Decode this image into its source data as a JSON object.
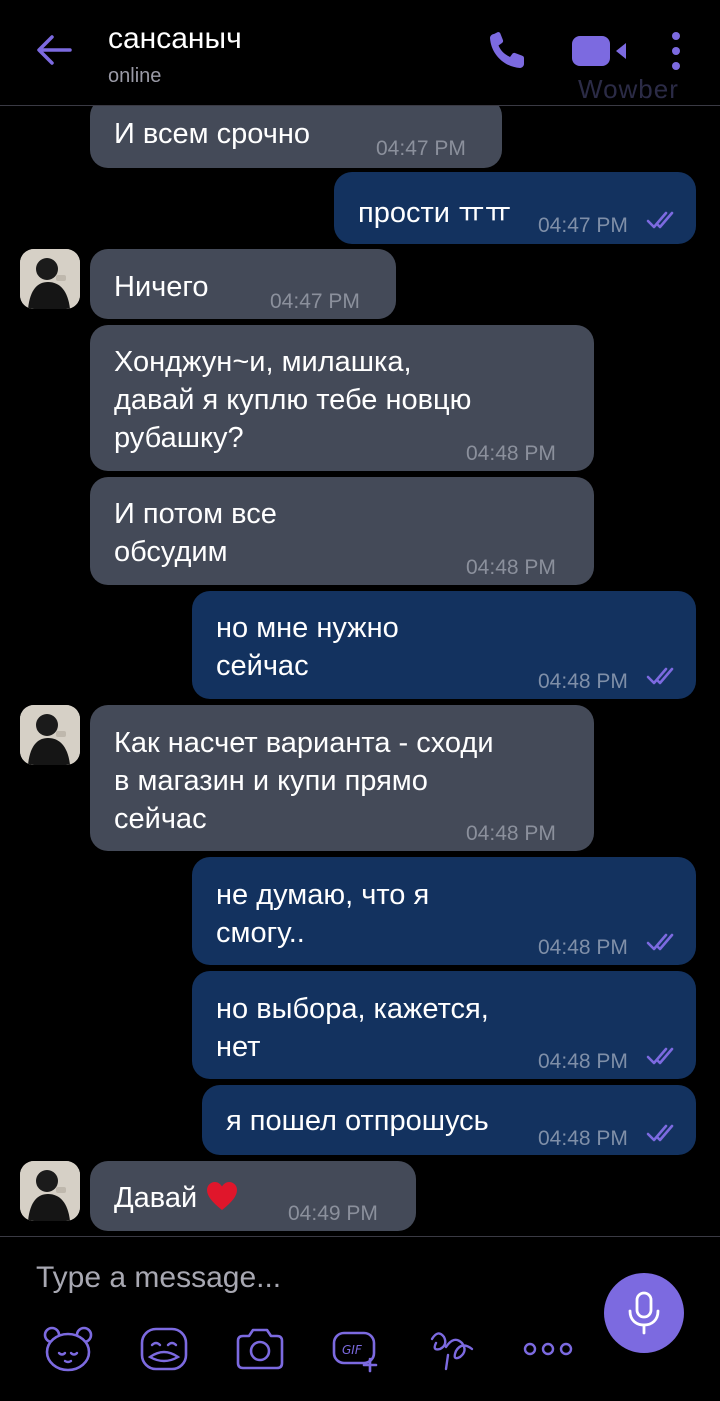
{
  "header": {
    "contact_name": "сансаныч",
    "status": "online",
    "brand_watermark": "Wowber",
    "back_icon": "arrow-left-icon",
    "call_icon": "phone-icon",
    "video_icon": "video-camera-icon",
    "more_icon": "more-vertical-icon"
  },
  "colors": {
    "accent": "#7c6ae0",
    "incoming_bubble": "#444a58",
    "outgoing_bubble": "#13325f",
    "background": "#000000",
    "heart": "#e0162b"
  },
  "messages": [
    {
      "direction": "in",
      "text": "И всем срочно",
      "time": "04:47 PM"
    },
    {
      "direction": "out",
      "text": "прости ㅠㅠ",
      "time": "04:47 PM",
      "read": true
    },
    {
      "direction": "in",
      "text": "Ничего",
      "time": "04:47 PM"
    },
    {
      "direction": "in",
      "text": "Хонджун~и, милашка,\nдавай я куплю тебе новцю\nрубашку?",
      "time": "04:48 PM"
    },
    {
      "direction": "in",
      "text": "И потом все\nобсудим",
      "time": "04:48 PM"
    },
    {
      "direction": "out",
      "text": "но мне нужно\nсейчас",
      "time": "04:48 PM",
      "read": true
    },
    {
      "direction": "in",
      "text": "Как насчет варианта - сходи\nв магазин и купи прямо\nсейчас",
      "time": "04:48 PM"
    },
    {
      "direction": "out",
      "text": "не думаю, что я\nсмогу..",
      "time": "04:48 PM",
      "read": true
    },
    {
      "direction": "out",
      "text": "но выбора, кажется,\nнет",
      "time": "04:48 PM",
      "read": true
    },
    {
      "direction": "out",
      "text": "я пошел отпрошусь",
      "time": "04:48 PM",
      "read": true
    },
    {
      "direction": "in",
      "text": "Давай",
      "time": "04:49 PM",
      "emoji": "heart-emoji"
    }
  ],
  "composer": {
    "placeholder": "Type a message...",
    "mic_icon": "microphone-icon",
    "tools": [
      "bear-sticker-icon",
      "sticker-face-icon",
      "camera-icon",
      "gif-icon",
      "doodle-icon",
      "more-horizontal-icon"
    ]
  }
}
